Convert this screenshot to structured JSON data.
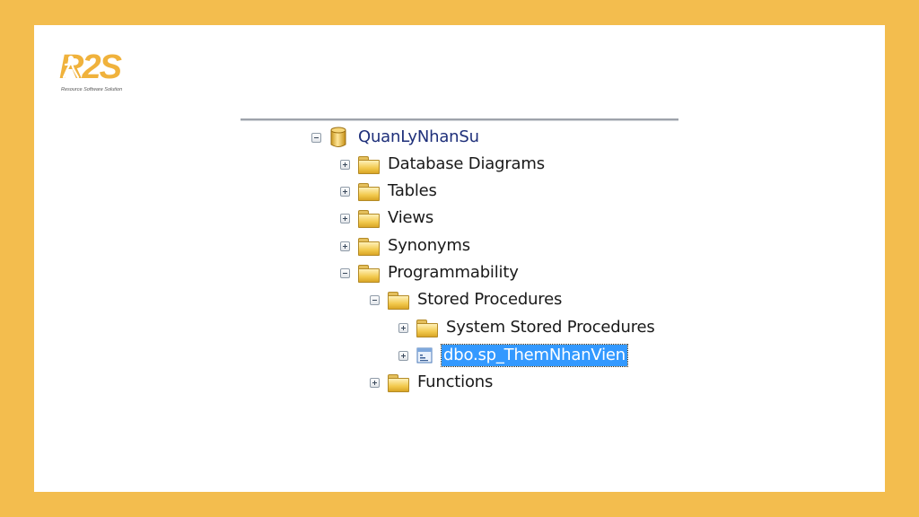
{
  "brand": {
    "logo_text": "R2S",
    "tagline": "Resource Software Solution",
    "background_color": "#F3BD4E"
  },
  "tree": {
    "database": {
      "label": "QuanLyNhanSu",
      "icon": "database-icon",
      "expanded": true
    },
    "nodes": [
      {
        "label": "Database Diagrams",
        "icon": "folder-icon",
        "expanded": false,
        "level": 1
      },
      {
        "label": "Tables",
        "icon": "folder-icon",
        "expanded": false,
        "level": 1
      },
      {
        "label": "Views",
        "icon": "folder-icon",
        "expanded": false,
        "level": 1
      },
      {
        "label": "Synonyms",
        "icon": "folder-icon",
        "expanded": false,
        "level": 1
      },
      {
        "label": "Programmability",
        "icon": "folder-icon",
        "expanded": true,
        "level": 1
      },
      {
        "label": "Stored Procedures",
        "icon": "folder-icon",
        "expanded": true,
        "level": 2
      },
      {
        "label": "System Stored Procedures",
        "icon": "folder-icon",
        "expanded": false,
        "level": 3
      },
      {
        "label": "dbo.sp_ThemNhanVien",
        "icon": "stored-procedure-icon",
        "expanded": false,
        "level": 3,
        "selected": true
      },
      {
        "label": "Functions",
        "icon": "folder-icon",
        "expanded": false,
        "level": 2
      }
    ]
  }
}
